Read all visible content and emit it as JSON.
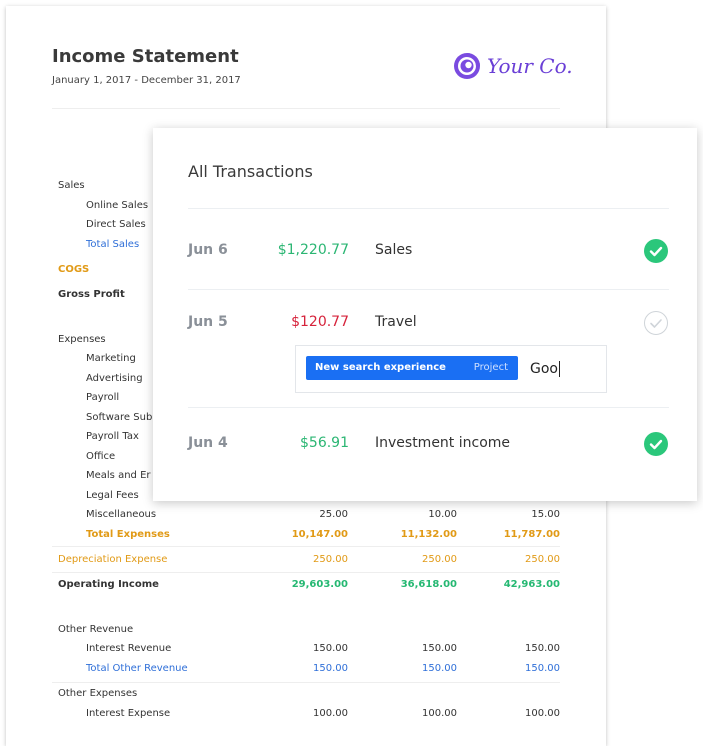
{
  "statement": {
    "title": "Income Statement",
    "period": "January 1, 2017 - December 31, 2017",
    "logo_text": "Your Co.",
    "rows": {
      "sales": "Sales",
      "online_sales": "Online Sales",
      "direct_sales": "Direct Sales",
      "total_sales": "Total Sales",
      "cogs": "COGS",
      "gross_profit": "Gross Profit",
      "expenses": "Expenses",
      "marketing": "Marketing",
      "advertising": "Advertising",
      "payroll": "Payroll",
      "software_sub": "Software Sub",
      "payroll_tax": "Payroll Tax",
      "office": "Office",
      "meals": "Meals and Er",
      "legal": "Legal Fees",
      "misc": {
        "label": "Miscellaneous",
        "v": [
          "25.00",
          "10.00",
          "15.00"
        ]
      },
      "total_expenses": {
        "label": "Total Expenses",
        "v": [
          "10,147.00",
          "11,132.00",
          "11,787.00"
        ]
      },
      "depreciation": {
        "label": "Depreciation Expense",
        "v": [
          "250.00",
          "250.00",
          "250.00"
        ]
      },
      "operating_income": {
        "label": "Operating Income",
        "v": [
          "29,603.00",
          "36,618.00",
          "42,963.00"
        ]
      },
      "other_revenue": "Other Revenue",
      "interest_revenue": {
        "label": "Interest Revenue",
        "v": [
          "150.00",
          "150.00",
          "150.00"
        ]
      },
      "total_other_revenue": {
        "label": "Total Other Revenue",
        "v": [
          "150.00",
          "150.00",
          "150.00"
        ]
      },
      "other_expenses": "Other Expenses",
      "interest_expense": {
        "label": "Interest Expense",
        "v": [
          "100.00",
          "100.00",
          "100.00"
        ]
      }
    }
  },
  "modal": {
    "title": "All Transactions",
    "transactions": [
      {
        "date": "Jun 6",
        "amount": "$1,220.77",
        "category": "Sales",
        "status": "checked-circle-icon"
      },
      {
        "date": "Jun 5",
        "amount": "$120.77",
        "category": "Travel",
        "status": "unchecked-circle-icon"
      },
      {
        "date": "Jun 4",
        "amount": "$56.91",
        "category": "Investment income",
        "status": "checked-circle-icon"
      }
    ],
    "search": {
      "suggestion": "New search experience",
      "suggestion_type": "Project",
      "query": "Goo"
    }
  },
  "colors": {
    "green": "#2bb673",
    "red": "#d6233b",
    "blue": "#1a6ff3",
    "orange": "#e19a16",
    "purple": "#6a3fd6"
  }
}
